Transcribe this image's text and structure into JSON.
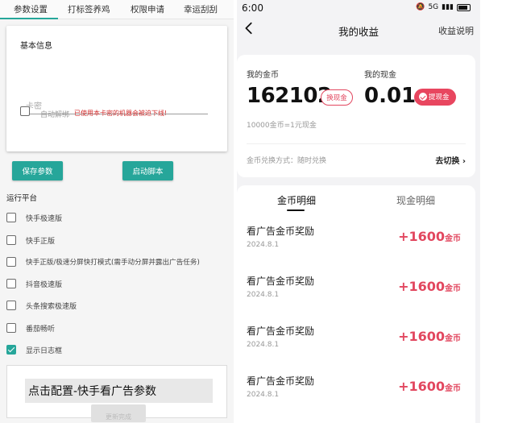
{
  "left": {
    "tabs": [
      "参数设置",
      "打标签养鸡",
      "权限申请",
      "幸运刮刮"
    ],
    "card_title": "基本信息",
    "key_placeholder": "卡密",
    "auto_unbind_label": "自动解绑",
    "warning": "已使用本卡密的机器会被迫下线!",
    "save_label": "保存参数",
    "start_label": "启动脚本",
    "platform_label": "运行平台",
    "platforms": [
      {
        "label": "快手极速版",
        "checked": false
      },
      {
        "label": "快手正版",
        "checked": false
      },
      {
        "label": "快手正版/极速分屏快打模式(需手动分屏并露出广告任务)",
        "checked": false
      },
      {
        "label": "抖音极速版",
        "checked": false
      },
      {
        "label": "头条搜索极速版",
        "checked": false
      },
      {
        "label": "番茄畅听",
        "checked": false
      },
      {
        "label": "显示日志框",
        "checked": true
      }
    ],
    "config_label": "点击配置-快手看广告参数",
    "update_label": "更新完成"
  },
  "right": {
    "status": {
      "time": "6:00",
      "network": "5G",
      "battery_icon": "battery-icon"
    },
    "nav": {
      "title": "我的收益",
      "right_label": "收益说明",
      "back_icon": "chevron-left-icon"
    },
    "earnings": {
      "coin_label": "我的金币",
      "coin_value": "162102",
      "exchange_label": "换现金",
      "cash_label": "我的现金",
      "cash_value": "0.01",
      "withdraw_label": "提现金",
      "rate": "10000金币=1元现金",
      "method": "金币兑换方式：随时兑换",
      "switch_label": "去切换 ›"
    },
    "detail_tabs": {
      "active": "金币明细",
      "inactive": "现金明细"
    },
    "records": [
      {
        "title": "看广告金币奖励",
        "date": "2024.8.1",
        "amount": "+1600",
        "unit": "金币"
      },
      {
        "title": "看广告金币奖励",
        "date": "2024.8.1",
        "amount": "+1600",
        "unit": "金币"
      },
      {
        "title": "看广告金币奖励",
        "date": "2024.8.1",
        "amount": "+1600",
        "unit": "金币"
      },
      {
        "title": "看广告金币奖励",
        "date": "2024.8.1",
        "amount": "+1600",
        "unit": "金币"
      }
    ],
    "accent": "#e2475f"
  },
  "accent_teal": "#26a69a"
}
